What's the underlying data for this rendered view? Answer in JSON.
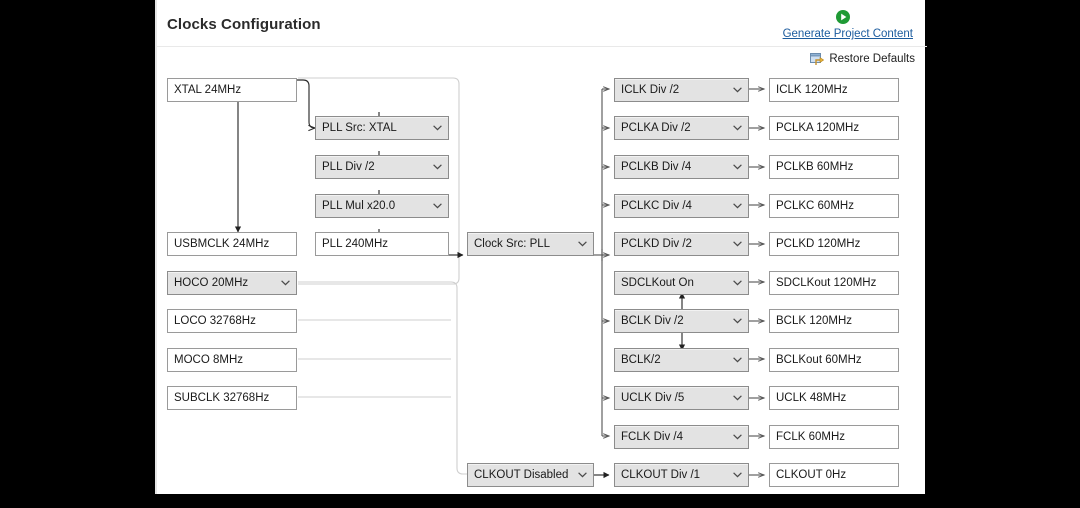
{
  "panel": {
    "title": "Clocks Configuration",
    "generate_link": "Generate Project Content",
    "generate_icon": "play-circle-icon",
    "restore_label": "Restore Defaults",
    "restore_icon": "restore-defaults-icon",
    "link_color": "#1c5c9e",
    "accent_green": "#1f9a35"
  },
  "nodes": {
    "xtal": {
      "label": "XTAL 24MHz",
      "type": "readonly"
    },
    "usbmclk": {
      "label": "USBMCLK 24MHz",
      "type": "readonly"
    },
    "hoco": {
      "label": "HOCO 20MHz",
      "type": "select"
    },
    "loco": {
      "label": "LOCO 32768Hz",
      "type": "readonly"
    },
    "moco": {
      "label": "MOCO 8MHz",
      "type": "readonly"
    },
    "subclk": {
      "label": "SUBCLK 32768Hz",
      "type": "readonly"
    },
    "pll_src": {
      "label": "PLL Src: XTAL",
      "type": "select"
    },
    "pll_div": {
      "label": "PLL Div /2",
      "type": "select"
    },
    "pll_mul": {
      "label": "PLL Mul x20.0",
      "type": "select"
    },
    "pll_out": {
      "label": "PLL 240MHz",
      "type": "readonly"
    },
    "clock_src": {
      "label": "Clock Src: PLL",
      "type": "select"
    },
    "iclk_div": {
      "label": "ICLK Div /2",
      "type": "select"
    },
    "pclka_div": {
      "label": "PCLKA Div /2",
      "type": "select"
    },
    "pclkb_div": {
      "label": "PCLKB Div /4",
      "type": "select"
    },
    "pclkc_div": {
      "label": "PCLKC Div /4",
      "type": "select"
    },
    "pclkd_div": {
      "label": "PCLKD Div /2",
      "type": "select"
    },
    "sdclkout": {
      "label": "SDCLKout On",
      "type": "select"
    },
    "bclk_div": {
      "label": "BCLK Div /2",
      "type": "select"
    },
    "bclk_half": {
      "label": "BCLK/2",
      "type": "select"
    },
    "uclk_div": {
      "label": "UCLK Div /5",
      "type": "select"
    },
    "fclk_div": {
      "label": "FCLK Div /4",
      "type": "select"
    },
    "clkout_src": {
      "label": "CLKOUT Disabled",
      "type": "select"
    },
    "clkout_div": {
      "label": "CLKOUT Div /1",
      "type": "select"
    },
    "iclk_out": {
      "label": "ICLK 120MHz",
      "type": "readonly"
    },
    "pclka_out": {
      "label": "PCLKA 120MHz",
      "type": "readonly"
    },
    "pclkb_out": {
      "label": "PCLKB 60MHz",
      "type": "readonly"
    },
    "pclkc_out": {
      "label": "PCLKC 60MHz",
      "type": "readonly"
    },
    "pclkd_out": {
      "label": "PCLKD 120MHz",
      "type": "readonly"
    },
    "sdclkout_out": {
      "label": "SDCLKout 120MHz",
      "type": "readonly"
    },
    "bclk_out": {
      "label": "BCLK 120MHz",
      "type": "readonly"
    },
    "bclkout_out": {
      "label": "BCLKout 60MHz",
      "type": "readonly"
    },
    "uclk_out": {
      "label": "UCLK 48MHz",
      "type": "readonly"
    },
    "fclk_out": {
      "label": "FCLK 60MHz",
      "type": "readonly"
    },
    "clkout_out": {
      "label": "CLKOUT 0Hz",
      "type": "readonly"
    }
  }
}
